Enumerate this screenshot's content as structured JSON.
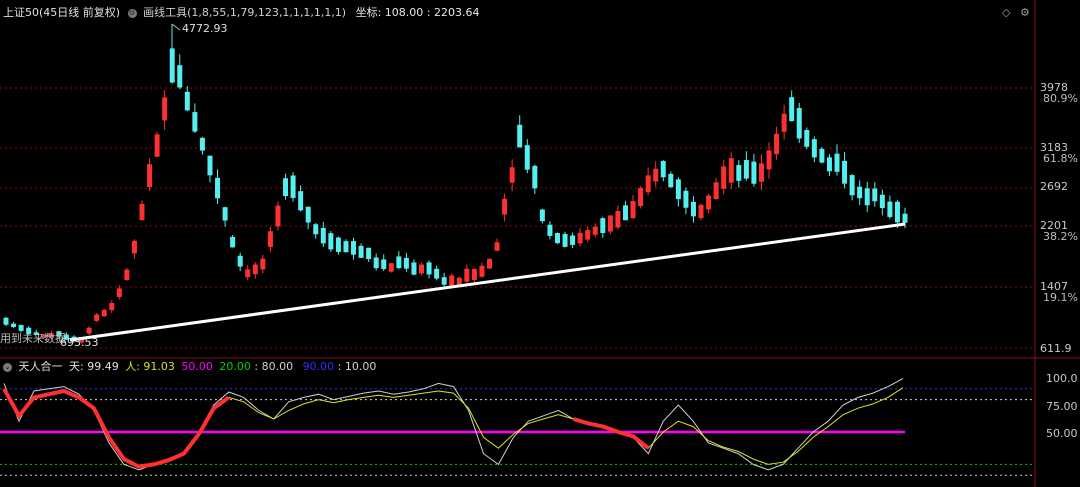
{
  "header": {
    "title": "上证50(45日线 前复权)",
    "tool_label": "画线工具(1,8,55,1,79,123,1,1,1,1,1,1)",
    "coord_label": "坐标: 108.00 : 2203.64"
  },
  "price_axis": {
    "ticks": [
      {
        "value": "3978",
        "pct": "80.9%"
      },
      {
        "value": "3183",
        "pct": "61.8%"
      },
      {
        "value": "2692",
        "pct": ""
      },
      {
        "value": "2201",
        "pct": "38.2%"
      },
      {
        "value": "1407",
        "pct": "19.1%"
      },
      {
        "value": "611.9",
        "pct": ""
      }
    ]
  },
  "annotations": {
    "high": "4772.93",
    "low": "693.53",
    "future_data": "用到未来数据"
  },
  "indicator": {
    "name": "天人合一",
    "tian_label": "天: 99.49",
    "ren_label": "人: 91.03",
    "level_50": "50.00",
    "level_20": "20.00",
    "level_80": "80.00",
    "level_90": "90.00",
    "level_10": "10.00",
    "axis_ticks": [
      "100.0",
      "75.00",
      "50.00"
    ]
  },
  "colors": {
    "up": "#ff3030",
    "down": "#54f0f0",
    "trendline": "#ffffff",
    "tian_line": "#d0d0d0",
    "ren_line": "#e0e020",
    "magenta": "#ff00ff",
    "level_20": "#00d000",
    "level_90": "#3030ff",
    "grid": "#8a1010"
  },
  "chart_data": [
    {
      "type": "candlestick",
      "title": "上证50(45日线 前复权)",
      "high": 4772.93,
      "low": 693.53,
      "y_ticks": [
        611.9,
        1407,
        2201,
        2692,
        3183,
        3978
      ],
      "close_path": [
        960,
        870,
        820,
        760,
        800,
        740,
        700,
        1000,
        1100,
        1350,
        1900,
        2700,
        3300,
        4300,
        3900,
        3400,
        2900,
        2400,
        1800,
        1550,
        1700,
        2200,
        2800,
        2500,
        2200,
        2000,
        1950,
        1900,
        1850,
        1700,
        1650,
        1750,
        1600,
        1650,
        1500,
        1450,
        1550,
        1600,
        1750,
        2600,
        3300,
        2900,
        2200,
        2050,
        2000,
        2050,
        2150,
        2200,
        2350,
        2400,
        2700,
        2950,
        2750,
        2500,
        2400,
        2600,
        2850,
        2900,
        2850,
        2900,
        3250,
        3700,
        3400,
        3200,
        3000,
        2950,
        2700,
        2550,
        2600,
        2400,
        2300
      ]
    },
    {
      "type": "line",
      "title": "天人合一",
      "y_ticks": [
        50,
        75,
        100
      ],
      "levels": [
        10,
        20,
        50,
        80,
        90
      ],
      "series": [
        {
          "name": "天",
          "values": [
            95,
            60,
            88,
            90,
            92,
            85,
            70,
            40,
            20,
            15,
            20,
            25,
            30,
            50,
            75,
            87,
            82,
            70,
            62,
            78,
            82,
            85,
            80,
            83,
            86,
            88,
            85,
            87,
            90,
            95,
            92,
            70,
            30,
            20,
            45,
            60,
            65,
            70,
            62,
            58,
            56,
            50,
            45,
            30,
            60,
            75,
            60,
            40,
            35,
            30,
            20,
            15,
            20,
            35,
            50,
            60,
            75,
            82,
            86,
            92,
            99.49
          ]
        },
        {
          "name": "人",
          "values": [
            90,
            65,
            82,
            85,
            88,
            82,
            72,
            45,
            25,
            18,
            20,
            24,
            30,
            48,
            72,
            82,
            78,
            68,
            62,
            70,
            76,
            80,
            77,
            80,
            82,
            84,
            82,
            84,
            86,
            88,
            86,
            72,
            45,
            35,
            48,
            58,
            62,
            66,
            62,
            58,
            55,
            50,
            46,
            35,
            50,
            60,
            55,
            42,
            36,
            32,
            25,
            20,
            22,
            32,
            45,
            55,
            66,
            72,
            76,
            82,
            91.03
          ]
        }
      ]
    }
  ]
}
